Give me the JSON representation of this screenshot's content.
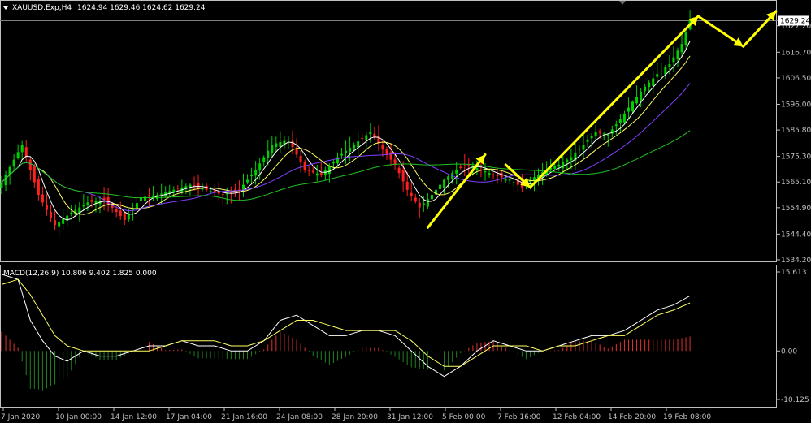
{
  "main_panel": {
    "title": "XAUUSD.Exp,H4",
    "ohlc": "1624.94 1629.46 1624.62 1629.24",
    "menu_icon": "triangle-down-icon",
    "current_price_label": "1629.24",
    "current_price": 1629.24
  },
  "macd_panel": {
    "title": "MACD(12,26,9) 10.806 9.402 1.825 0.000"
  },
  "colors": {
    "background": "#000000",
    "axis": "#c0c0c0",
    "bull_candle": "#00d000",
    "bear_candle": "#ff2020",
    "ma_fast": "#ffffff",
    "ma_mid": "#ffff60",
    "ma_slow": "#8040ff",
    "ma_long": "#20c020",
    "annotation_arrow": "#ffff00",
    "macd_line": "#ffffff",
    "signal_line": "#ffff60",
    "hist_pos": "#e03030",
    "hist_neg": "#208020"
  },
  "chart_data": [
    {
      "type": "candlestick",
      "symbol": "XAUUSD.Exp",
      "timeframe": "H4",
      "ylim": [
        1534.2,
        1631.0
      ],
      "y_ticks": [
        "1629.24",
        "1627.20",
        "1616.70",
        "1606.50",
        "1596.00",
        "1585.80",
        "1575.30",
        "1565.10",
        "1554.90",
        "1544.40",
        "1534.20"
      ],
      "x_ticks": [
        "7 Jan 2020",
        "10 Jan 00:00",
        "14 Jan 12:00",
        "17 Jan 04:00",
        "21 Jan 16:00",
        "24 Jan 08:00",
        "28 Jan 20:00",
        "31 Jan 12:00",
        "5 Feb 00:00",
        "7 Feb 16:00",
        "12 Feb 04:00",
        "14 Feb 20:00",
        "19 Feb 08:00"
      ],
      "close_path": [
        [
          0,
          1565
        ],
        [
          5,
          1580
        ],
        [
          9,
          1560
        ],
        [
          13,
          1548
        ],
        [
          17,
          1553
        ],
        [
          21,
          1557
        ],
        [
          25,
          1558
        ],
        [
          30,
          1550
        ],
        [
          34,
          1559
        ],
        [
          38,
          1560
        ],
        [
          42,
          1562
        ],
        [
          46,
          1564
        ],
        [
          50,
          1562
        ],
        [
          54,
          1560
        ],
        [
          58,
          1562
        ],
        [
          62,
          1570
        ],
        [
          66,
          1580
        ],
        [
          70,
          1582
        ],
        [
          74,
          1570
        ],
        [
          78,
          1568
        ],
        [
          82,
          1575
        ],
        [
          86,
          1580
        ],
        [
          90,
          1585
        ],
        [
          93,
          1578
        ],
        [
          96,
          1572
        ],
        [
          99,
          1562
        ],
        [
          102,
          1555
        ],
        [
          105,
          1560
        ],
        [
          108,
          1566
        ],
        [
          111,
          1570
        ],
        [
          114,
          1572
        ],
        [
          117,
          1570
        ],
        [
          120,
          1568
        ],
        [
          124,
          1566
        ],
        [
          127,
          1563
        ],
        [
          130,
          1567
        ],
        [
          133,
          1570
        ],
        [
          136,
          1572
        ],
        [
          139,
          1575
        ],
        [
          142,
          1580
        ],
        [
          145,
          1585
        ],
        [
          148,
          1584
        ],
        [
          151,
          1590
        ],
        [
          154,
          1597
        ],
        [
          157,
          1603
        ],
        [
          160,
          1608
        ],
        [
          163,
          1612
        ],
        [
          166,
          1620
        ],
        [
          168,
          1629.24
        ]
      ],
      "annotations": [
        {
          "type": "arrow",
          "from": [
            104,
            1547
          ],
          "to": [
            118,
            1576
          ]
        },
        {
          "type": "arrow",
          "from": [
            123,
            1572
          ],
          "to": [
            129,
            1563
          ]
        },
        {
          "type": "arrow",
          "from": [
            129,
            1563
          ],
          "to": [
            170,
            1631
          ]
        },
        {
          "type": "arrow",
          "from": [
            170,
            1631
          ],
          "to": [
            181,
            1619
          ]
        },
        {
          "type": "arrow",
          "from": [
            181,
            1619
          ],
          "to": [
            189,
            1633
          ]
        }
      ]
    },
    {
      "type": "line",
      "name": "MACD(12,26,9)",
      "y_ticks": [
        "15.613",
        "0.00",
        "-10.125"
      ],
      "ylim": [
        -10.125,
        15.613
      ],
      "macd_path": [
        [
          0,
          15
        ],
        [
          4,
          14
        ],
        [
          7,
          6
        ],
        [
          10,
          2
        ],
        [
          13,
          -1
        ],
        [
          16,
          -2
        ],
        [
          20,
          0
        ],
        [
          24,
          -1
        ],
        [
          28,
          -1
        ],
        [
          32,
          0
        ],
        [
          36,
          1
        ],
        [
          40,
          1
        ],
        [
          44,
          2
        ],
        [
          48,
          1
        ],
        [
          52,
          1
        ],
        [
          56,
          0
        ],
        [
          60,
          0
        ],
        [
          64,
          2
        ],
        [
          68,
          6
        ],
        [
          72,
          7
        ],
        [
          76,
          5
        ],
        [
          80,
          3
        ],
        [
          84,
          3
        ],
        [
          88,
          4
        ],
        [
          92,
          4
        ],
        [
          96,
          3
        ],
        [
          100,
          0
        ],
        [
          104,
          -3
        ],
        [
          108,
          -5
        ],
        [
          112,
          -3
        ],
        [
          116,
          0
        ],
        [
          120,
          2
        ],
        [
          124,
          1
        ],
        [
          128,
          0
        ],
        [
          132,
          0
        ],
        [
          136,
          1
        ],
        [
          140,
          2
        ],
        [
          144,
          3
        ],
        [
          148,
          3
        ],
        [
          152,
          4
        ],
        [
          156,
          6
        ],
        [
          160,
          8
        ],
        [
          164,
          9
        ],
        [
          168,
          10.8
        ]
      ],
      "signal_path": [
        [
          0,
          13
        ],
        [
          4,
          14
        ],
        [
          7,
          11
        ],
        [
          10,
          7
        ],
        [
          13,
          3
        ],
        [
          16,
          1
        ],
        [
          20,
          0
        ],
        [
          24,
          0
        ],
        [
          28,
          0
        ],
        [
          32,
          0
        ],
        [
          36,
          0
        ],
        [
          40,
          1
        ],
        [
          44,
          2
        ],
        [
          48,
          2
        ],
        [
          52,
          2
        ],
        [
          56,
          1
        ],
        [
          60,
          1
        ],
        [
          64,
          2
        ],
        [
          68,
          4
        ],
        [
          72,
          6
        ],
        [
          76,
          6
        ],
        [
          80,
          5
        ],
        [
          84,
          4
        ],
        [
          88,
          4
        ],
        [
          92,
          4
        ],
        [
          96,
          4
        ],
        [
          100,
          2
        ],
        [
          104,
          -1
        ],
        [
          108,
          -3
        ],
        [
          112,
          -3
        ],
        [
          116,
          -1
        ],
        [
          120,
          1
        ],
        [
          124,
          1
        ],
        [
          128,
          1
        ],
        [
          132,
          0
        ],
        [
          136,
          1
        ],
        [
          140,
          1
        ],
        [
          144,
          2
        ],
        [
          148,
          3
        ],
        [
          152,
          3
        ],
        [
          156,
          5
        ],
        [
          160,
          7
        ],
        [
          164,
          8
        ],
        [
          168,
          9.4
        ]
      ]
    }
  ]
}
